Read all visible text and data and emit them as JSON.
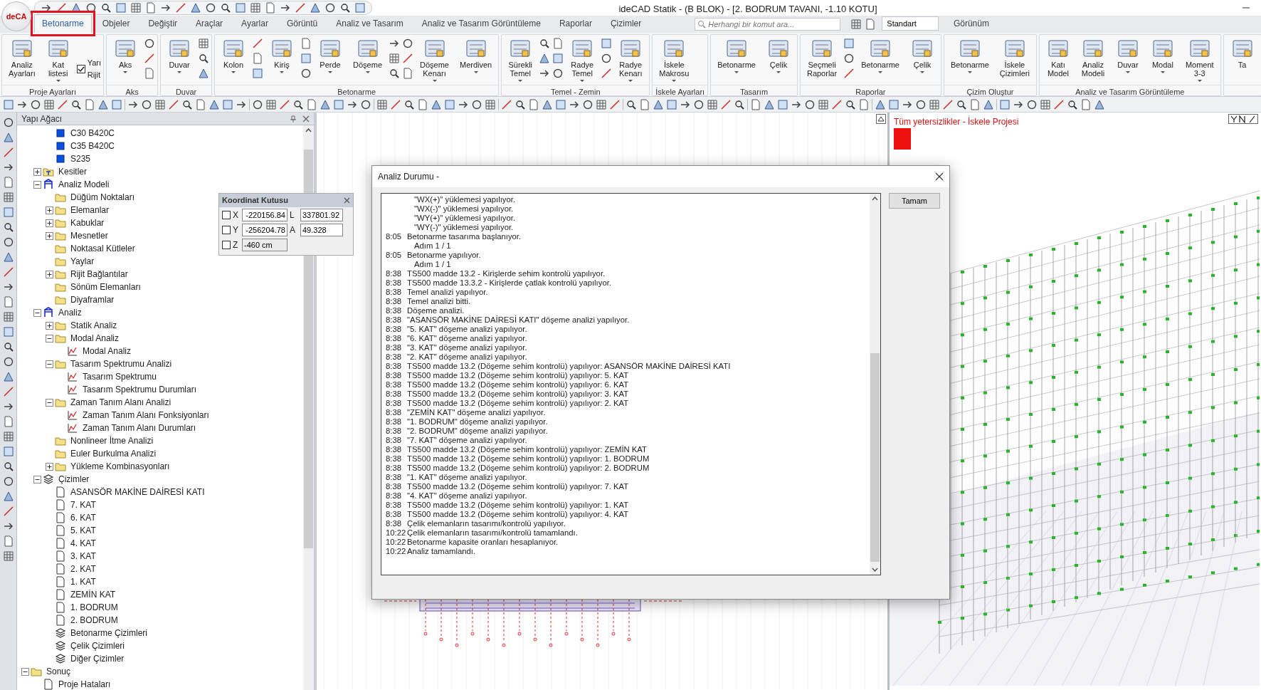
{
  "window": {
    "title": "ideCAD Statik - (B BLOK) - [2. BODRUM TAVANI, -1.10 KOTU]",
    "logo": "deCA"
  },
  "ribbon_tabs": [
    {
      "label": "Betonarme",
      "selected": true,
      "highlighted": true
    },
    {
      "label": "Objeler",
      "selected": false,
      "highlighted": false
    },
    {
      "label": "Değiştir",
      "selected": false,
      "highlighted": false
    },
    {
      "label": "Araçlar",
      "selected": false,
      "highlighted": false
    },
    {
      "label": "Ayarlar",
      "selected": false,
      "highlighted": false
    },
    {
      "label": "Görüntü",
      "selected": false,
      "highlighted": false
    },
    {
      "label": "Analiz ve Tasarım",
      "selected": false,
      "highlighted": false
    },
    {
      "label": "Analiz ve Tasarım Görüntüleme",
      "selected": false,
      "highlighted": false
    },
    {
      "label": "Raporlar",
      "selected": false,
      "highlighted": false
    },
    {
      "label": "Çizimler",
      "selected": false,
      "highlighted": false
    }
  ],
  "command_search": {
    "placeholder": "Herhangi bir komut ara..."
  },
  "workspace": {
    "value": "Standart"
  },
  "view_menu": "Görünüm",
  "ribbon_groups": [
    {
      "name": "Proje Ayarları",
      "items": [
        {
          "kind": "large",
          "label": "Analiz Ayarları",
          "dropdown": false
        },
        {
          "kind": "large",
          "label": "Kat listesi",
          "dropdown": true
        },
        {
          "kind": "check",
          "label": "Yarı Rijit",
          "checked": true
        }
      ]
    },
    {
      "name": "Aks",
      "items": [
        {
          "kind": "large",
          "label": "Aks",
          "dropdown": true
        },
        {
          "kind": "icons"
        }
      ]
    },
    {
      "name": "Duvar",
      "items": [
        {
          "kind": "large",
          "label": "Duvar",
          "dropdown": true
        },
        {
          "kind": "icons"
        }
      ]
    },
    {
      "name": "Betonarme",
      "items": [
        {
          "kind": "large",
          "label": "Kolon",
          "dropdown": true
        },
        {
          "kind": "icons"
        },
        {
          "kind": "large",
          "label": "Kiriş",
          "dropdown": true
        },
        {
          "kind": "icons"
        },
        {
          "kind": "large",
          "label": "Perde",
          "dropdown": true
        },
        {
          "kind": "large",
          "label": "Döşeme",
          "dropdown": true
        },
        {
          "kind": "icons"
        },
        {
          "kind": "icons"
        },
        {
          "kind": "large",
          "label": "Döşeme Kenarı",
          "dropdown": true
        },
        {
          "kind": "large",
          "label": "Merdiven",
          "dropdown": true
        }
      ]
    },
    {
      "name": "Temel - Zemin",
      "items": [
        {
          "kind": "large",
          "label": "Sürekli Temel",
          "dropdown": true
        },
        {
          "kind": "icons"
        },
        {
          "kind": "icons"
        },
        {
          "kind": "large",
          "label": "Radye Temel",
          "dropdown": true
        },
        {
          "kind": "icons"
        },
        {
          "kind": "large",
          "label": "Radye Kenarı",
          "dropdown": true
        }
      ]
    },
    {
      "name": "İskele Ayarları",
      "items": [
        {
          "kind": "large",
          "label": "İskele Makrosu",
          "dropdown": true
        }
      ]
    },
    {
      "name": "Tasarım",
      "items": [
        {
          "kind": "large",
          "label": "Betonarme",
          "dropdown": true
        },
        {
          "kind": "large",
          "label": "Çelik",
          "dropdown": true
        }
      ]
    },
    {
      "name": "Raporlar",
      "items": [
        {
          "kind": "large",
          "label": "Seçmeli Raporlar",
          "dropdown": false
        },
        {
          "kind": "icons"
        },
        {
          "kind": "large",
          "label": "Betonarme",
          "dropdown": true
        },
        {
          "kind": "large",
          "label": "Çelik",
          "dropdown": true
        }
      ]
    },
    {
      "name": "Çizim Oluştur",
      "items": [
        {
          "kind": "large",
          "label": "Betonarme",
          "dropdown": true
        },
        {
          "kind": "large",
          "label": "İskele Çizimleri",
          "dropdown": false
        }
      ]
    },
    {
      "name": "Analiz ve Tasarım Görüntüleme",
      "items": [
        {
          "kind": "large",
          "label": "Katı Model",
          "dropdown": false
        },
        {
          "kind": "large",
          "label": "Analiz Modeli",
          "dropdown": false
        },
        {
          "kind": "large",
          "label": "Duvar",
          "dropdown": true
        },
        {
          "kind": "large",
          "label": "Modal",
          "dropdown": true
        },
        {
          "kind": "large",
          "label": "Moment 3-3",
          "dropdown": true
        }
      ]
    },
    {
      "items": [
        {
          "kind": "large",
          "label": "Ta",
          "dropdown": false
        }
      ]
    }
  ],
  "tree_panel": {
    "title": "Yapı Ağacı",
    "nodes": [
      {
        "children": [
          {
            "children": [
              {
                "label": "C30 B420C",
                "kind": "material"
              },
              {
                "label": "C35 B420C",
                "kind": "material"
              },
              {
                "label": "S235",
                "kind": "material"
              }
            ]
          },
          {
            "label": "Kesitler",
            "kind": "section",
            "expanded": false
          },
          {
            "label": "Analiz Modeli",
            "kind": "model",
            "expanded": true,
            "children": [
              {
                "label": "Düğüm Noktaları",
                "kind": "folder"
              },
              {
                "label": "Elemanlar",
                "kind": "folder",
                "expanded": false
              },
              {
                "label": "Kabuklar",
                "kind": "folder",
                "expanded": false
              },
              {
                "label": "Mesnetler",
                "kind": "folder",
                "expanded": false
              },
              {
                "label": "Noktasal Kütleler",
                "kind": "folder"
              },
              {
                "label": "Yaylar",
                "kind": "folder"
              },
              {
                "label": "Rijit Bağlantılar",
                "kind": "folder",
                "expanded": false
              },
              {
                "label": "Sönüm Elemanları",
                "kind": "folder"
              },
              {
                "label": "Diyaframlar",
                "kind": "folder"
              }
            ]
          },
          {
            "label": "Analiz",
            "kind": "model",
            "expanded": true,
            "children": [
              {
                "label": "Statik Analiz",
                "kind": "folder",
                "expanded": false
              },
              {
                "label": "Modal Analiz",
                "kind": "folder",
                "expanded": true,
                "children": [
                  {
                    "label": "Modal Analiz",
                    "kind": "graph"
                  }
                ]
              },
              {
                "label": "Tasarım Spektrumu Analizi",
                "kind": "folder",
                "expanded": true,
                "children": [
                  {
                    "label": "Tasarım Spektrumu",
                    "kind": "graph"
                  },
                  {
                    "label": "Tasarım Spektrumu Durumları",
                    "kind": "graph"
                  }
                ]
              },
              {
                "label": "Zaman Tanım Alanı Analizi",
                "kind": "folder",
                "expanded": true,
                "children": [
                  {
                    "label": "Zaman Tanım Alanı Fonksiyonları",
                    "kind": "graph"
                  },
                  {
                    "label": "Zaman Tanım Alanı Durumları",
                    "kind": "graph"
                  }
                ]
              },
              {
                "label": "Nonlineer İtme Analizi",
                "kind": "folder"
              },
              {
                "label": "Euler Burkulma Analizi",
                "kind": "folder"
              },
              {
                "label": "Yükleme Kombinasyonları",
                "kind": "folder",
                "expanded": false
              }
            ]
          },
          {
            "label": "Çizimler",
            "kind": "layers",
            "expanded": true,
            "children": [
              {
                "label": "ASANSÖR MAKİNE DAİRESİ KATI",
                "kind": "page"
              },
              {
                "label": "7. KAT",
                "kind": "page"
              },
              {
                "label": "6. KAT",
                "kind": "page"
              },
              {
                "label": "5. KAT",
                "kind": "page"
              },
              {
                "label": "4. KAT",
                "kind": "page"
              },
              {
                "label": "3. KAT",
                "kind": "page"
              },
              {
                "label": "2. KAT",
                "kind": "page"
              },
              {
                "label": "1. KAT",
                "kind": "page"
              },
              {
                "label": "ZEMİN KAT",
                "kind": "page"
              },
              {
                "label": "1. BODRUM",
                "kind": "page"
              },
              {
                "label": "2. BODRUM",
                "kind": "page"
              },
              {
                "label": "Betonarme Çizimleri",
                "kind": "layers"
              },
              {
                "label": "Çelik Çizimleri",
                "kind": "layers"
              },
              {
                "label": "Diğer Çizimler",
                "kind": "layers"
              }
            ]
          }
        ]
      },
      {
        "label": "Sonuç",
        "kind": "folder",
        "expanded": true,
        "children": [
          {
            "label": "Proje Hataları",
            "kind": "page"
          }
        ]
      }
    ]
  },
  "coordinate_box": {
    "title": "Koordinat Kutusu",
    "rows": [
      {
        "axis": "X",
        "checked": false,
        "value": "-220156.84",
        "extra_label": "L",
        "extra_value": "337801.92"
      },
      {
        "axis": "Y",
        "checked": false,
        "value": "-256204.78",
        "extra_label": "A",
        "extra_value": "49.328"
      },
      {
        "axis": "Z",
        "checked": false,
        "value": "-460 cm"
      }
    ]
  },
  "view_3d": {
    "title": "Tüm yetersizlikler - İskele Projesi"
  },
  "dialog": {
    "title": "Analiz Durumu -",
    "ok_button": "Tamam",
    "log": [
      {
        "text": "\"WX(+)\" yüklemesi yapılıyor."
      },
      {
        "text": "\"WX(-)\" yüklemesi yapılıyor."
      },
      {
        "text": "\"WY(+)\" yüklemesi yapılıyor."
      },
      {
        "text": "\"WY(-)\" yüklemesi yapılıyor."
      },
      {
        "time": "8:05",
        "text": "Betonarme tasarıma başlanıyor."
      },
      {
        "text": "Adım 1 / 1"
      },
      {
        "time": "8:05",
        "text": "Betonarme yapılıyor."
      },
      {
        "text": "Adım 1 / 1"
      },
      {
        "time": "8:38",
        "text": "TS500 madde 13.2 - Kirişlerde sehim kontrolü yapılıyor."
      },
      {
        "time": "8:38",
        "text": "TS500 madde 13.3.2 - Kirişlerde çatlak kontrolü yapılıyor."
      },
      {
        "time": "8:38",
        "text": "Temel analizi yapılıyor."
      },
      {
        "time": "8:38",
        "text": "Temel analizi bitti."
      },
      {
        "time": "8:38",
        "text": "Döşeme analizi."
      },
      {
        "time": "8:38",
        "text": "\"ASANSÖR MAKİNE DAİRESİ KATI\" döşeme analizi yapılıyor."
      },
      {
        "time": "8:38",
        "text": "\"5. KAT\" döşeme analizi yapılıyor."
      },
      {
        "time": "8:38",
        "text": "\"6. KAT\" döşeme analizi yapılıyor."
      },
      {
        "time": "8:38",
        "text": "\"3. KAT\" döşeme analizi yapılıyor."
      },
      {
        "time": "8:38",
        "text": "\"2. KAT\" döşeme analizi yapılıyor."
      },
      {
        "time": "8:38",
        "text": "TS500 madde 13.2 (Döşeme sehim kontrolü) yapılıyor: ASANSÖR MAKİNE DAİRESİ KATI"
      },
      {
        "time": "8:38",
        "text": "TS500 madde 13.2 (Döşeme sehim kontrolü) yapılıyor: 5. KAT"
      },
      {
        "time": "8:38",
        "text": "TS500 madde 13.2 (Döşeme sehim kontrolü) yapılıyor: 6. KAT"
      },
      {
        "time": "8:38",
        "text": "TS500 madde 13.2 (Döşeme sehim kontrolü) yapılıyor: 3. KAT"
      },
      {
        "time": "8:38",
        "text": "TS500 madde 13.2 (Döşeme sehim kontrolü) yapılıyor: 2. KAT"
      },
      {
        "time": "8:38",
        "text": "\"ZEMİN KAT\" döşeme analizi yapılıyor."
      },
      {
        "time": "8:38",
        "text": "\"1. BODRUM\" döşeme analizi yapılıyor."
      },
      {
        "time": "8:38",
        "text": "\"2. BODRUM\" döşeme analizi yapılıyor."
      },
      {
        "time": "8:38",
        "text": "\"7. KAT\" döşeme analizi yapılıyor."
      },
      {
        "time": "8:38",
        "text": "TS500 madde 13.2 (Döşeme sehim kontrolü) yapılıyor: ZEMİN KAT"
      },
      {
        "time": "8:38",
        "text": "TS500 madde 13.2 (Döşeme sehim kontrolü) yapılıyor: 1. BODRUM"
      },
      {
        "time": "8:38",
        "text": "TS500 madde 13.2 (Döşeme sehim kontrolü) yapılıyor: 2. BODRUM"
      },
      {
        "time": "8:38",
        "text": "\"1. KAT\" döşeme analizi yapılıyor."
      },
      {
        "time": "8:38",
        "text": "TS500 madde 13.2 (Döşeme sehim kontrolü) yapılıyor: 7. KAT"
      },
      {
        "time": "8:38",
        "text": "\"4. KAT\" döşeme analizi yapılıyor."
      },
      {
        "time": "8:38",
        "text": "TS500 madde 13.2 (Döşeme sehim kontrolü) yapılıyor: 1. KAT"
      },
      {
        "time": "8:38",
        "text": "TS500 madde 13.2 (Döşeme sehim kontrolü) yapılıyor: 4. KAT"
      },
      {
        "time": "8:38",
        "text": "Çelik elemanların tasarımı/kontrolü yapılıyor."
      },
      {
        "time": "10:22",
        "text": "Çelik elemanların tasarımı/kontrolü tamamlandı."
      },
      {
        "time": "10:22",
        "text": "Betonarme kapasite oranları hesaplanıyor."
      },
      {
        "time": "10:22",
        "text": "Analiz tamamlandı."
      }
    ]
  }
}
